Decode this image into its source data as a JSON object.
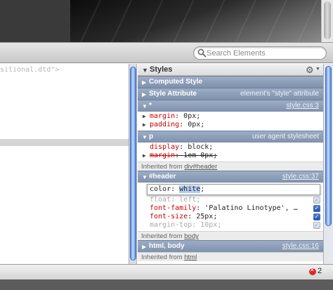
{
  "search": {
    "placeholder": "Search Elements"
  },
  "dom_pane": {
    "line1": "sitional.dtd\">"
  },
  "styles": {
    "title": "Styles",
    "computed_style": "Computed Style",
    "style_attribute": {
      "name": "Style Attribute",
      "right": "element's \"style\" attribute"
    },
    "rule_star": {
      "selector": "*",
      "source": "style.css:3",
      "props": [
        {
          "name": "margin",
          "value": "0px;"
        },
        {
          "name": "padding",
          "value": "0px;"
        }
      ]
    },
    "rule_p": {
      "selector": "p",
      "source": "user agent stylesheet",
      "props": [
        {
          "name": "display",
          "value": "block;"
        },
        {
          "name": "margin",
          "value": "1em 0px;"
        }
      ]
    },
    "inherited_header": {
      "prefix": "Inherited from ",
      "link": "div#header"
    },
    "rule_header": {
      "selector": "#header",
      "source": "style.css:37",
      "editing": {
        "name": "color",
        "value": "white",
        "suffix": ";"
      },
      "props": [
        {
          "name": "float",
          "value": "left;"
        },
        {
          "name": "font-family",
          "value": "'Palatino Linotype', …"
        },
        {
          "name": "font-size",
          "value": "25px;"
        },
        {
          "name": "margin-top",
          "value": "10px;"
        }
      ]
    },
    "inherited_body": {
      "prefix": "Inherited from ",
      "link": "body"
    },
    "rule_html_body": {
      "selector": "html, body",
      "source": "style.css:16"
    },
    "inherited_html": {
      "prefix": "Inherited from ",
      "link": "html"
    }
  },
  "status": {
    "error_count": "2"
  },
  "colors": {
    "property_name": "#c80000",
    "section_header": "#8799b3",
    "selection": "#b5cdf2"
  }
}
